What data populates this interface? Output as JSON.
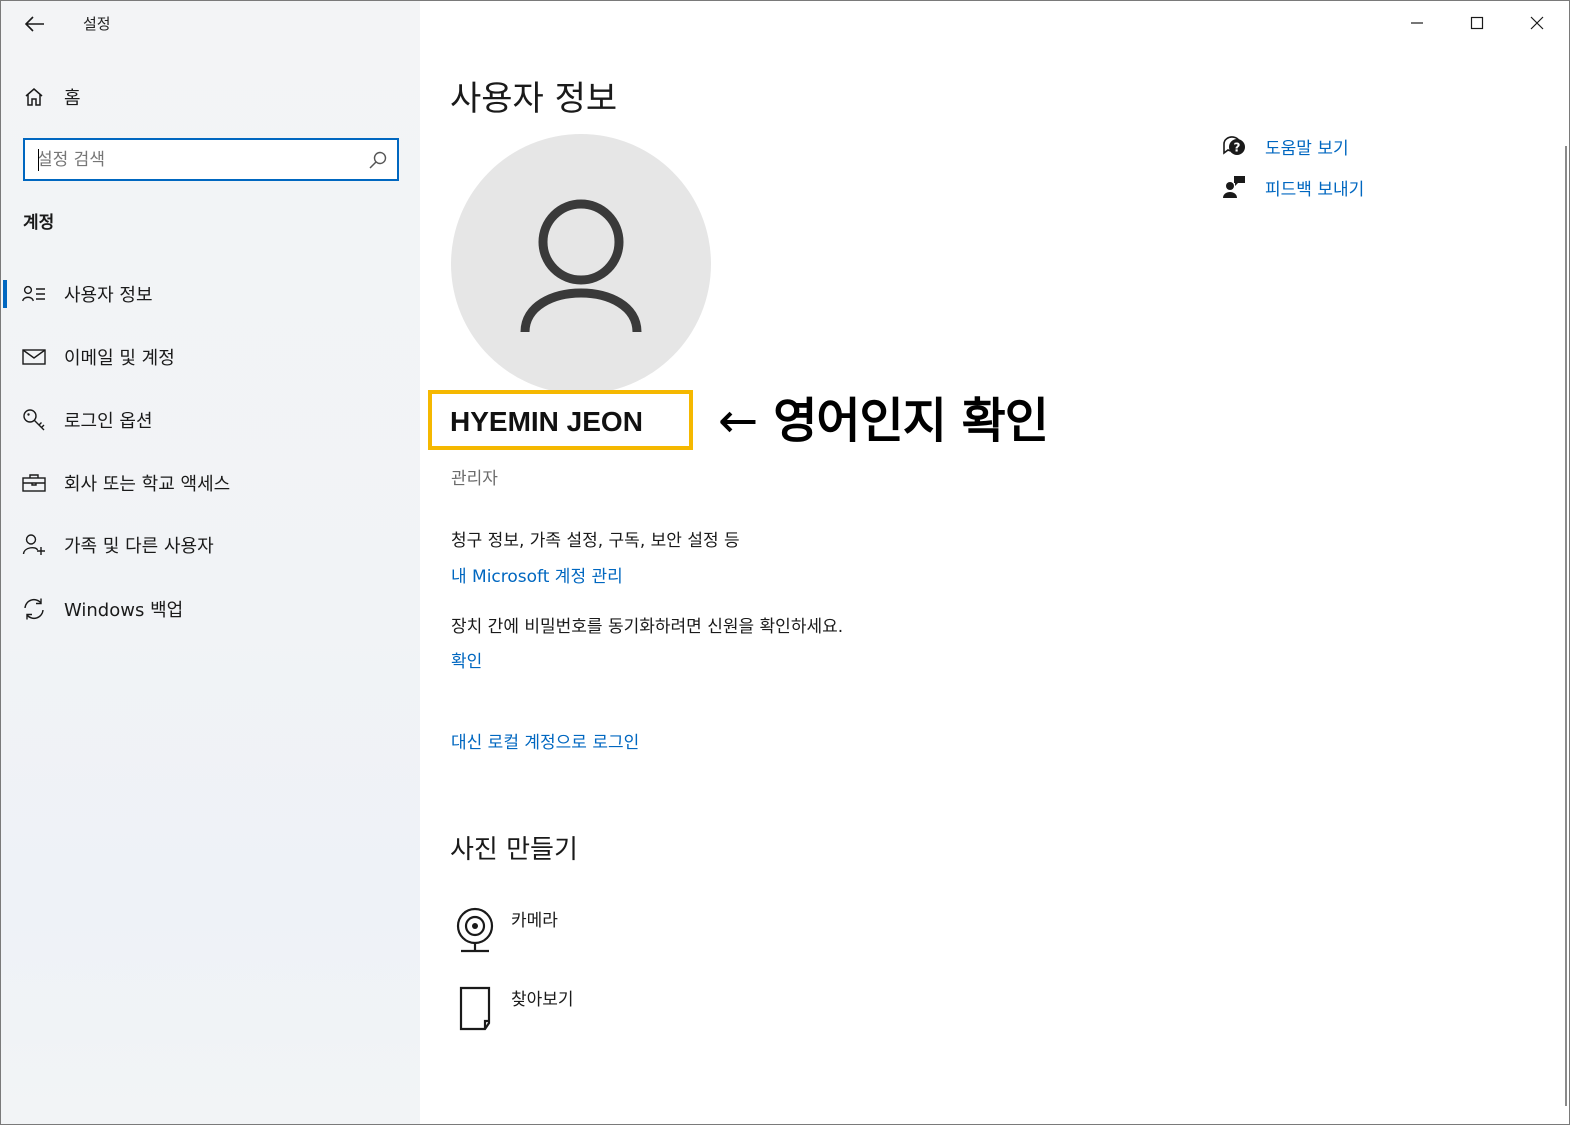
{
  "window": {
    "title": "설정"
  },
  "sidebar": {
    "home_label": "홈",
    "search": {
      "placeholder": "설정 검색",
      "value": ""
    },
    "section_heading": "계정",
    "items": [
      {
        "label": "사용자 정보",
        "icon": "person-list-icon",
        "selected": true
      },
      {
        "label": "이메일 및 계정",
        "icon": "mail-icon",
        "selected": false
      },
      {
        "label": "로그인 옵션",
        "icon": "key-icon",
        "selected": false
      },
      {
        "label": "회사 또는 학교 액세스",
        "icon": "briefcase-icon",
        "selected": false
      },
      {
        "label": "가족 및 다른 사용자",
        "icon": "person-add-icon",
        "selected": false
      },
      {
        "label": "Windows 백업",
        "icon": "sync-icon",
        "selected": false
      }
    ]
  },
  "main": {
    "page_title": "사용자 정보",
    "username": "HYEMIN JEON",
    "annotation": {
      "arrow": "←",
      "text": "영어인지 확인"
    },
    "role": "관리자",
    "billing_text": "청구 정보, 가족 설정, 구독, 보안 설정 등",
    "manage_account_link": "내 Microsoft 계정 관리",
    "sync_text": "장치 간에 비밀번호를 동기화하려면 신원을 확인하세요.",
    "verify_link": "확인",
    "local_account_link": "대신 로컬 계정으로 로그인",
    "create_photo_heading": "사진 만들기",
    "photo_options": [
      {
        "label": "카메라",
        "icon": "camera-icon"
      },
      {
        "label": "찾아보기",
        "icon": "browse-file-icon"
      }
    ],
    "help_links": [
      {
        "label": "도움말 보기",
        "icon": "help-chat-icon"
      },
      {
        "label": "피드백 보내기",
        "icon": "feedback-icon"
      }
    ]
  },
  "colors": {
    "accent": "#0067c0",
    "highlight_border": "#f5b800",
    "avatar_bg": "#e6e6e6"
  }
}
